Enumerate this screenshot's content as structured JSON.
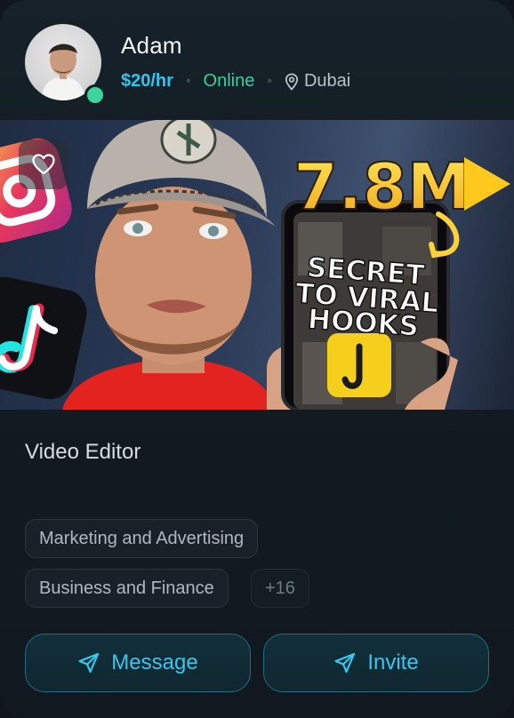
{
  "profile": {
    "name": "Adam",
    "rate": "$20/hr",
    "status": "Online",
    "location": "Dubai",
    "role": "Video Editor"
  },
  "media": {
    "views": "7.8M",
    "line1": "SECRET",
    "line2": "TO VIRAL",
    "line3": "HOOKS",
    "liked": false
  },
  "tags": {
    "items": [
      "Marketing and Advertising",
      "Business and Finance"
    ],
    "more": "+16"
  },
  "actions": {
    "message_label": "Message",
    "invite_label": "Invite"
  },
  "colors": {
    "accent": "#2fc5f0",
    "online": "#36d29a",
    "background": "#111820"
  },
  "icons": [
    "heart-icon",
    "location-pin-icon",
    "send-icon"
  ]
}
